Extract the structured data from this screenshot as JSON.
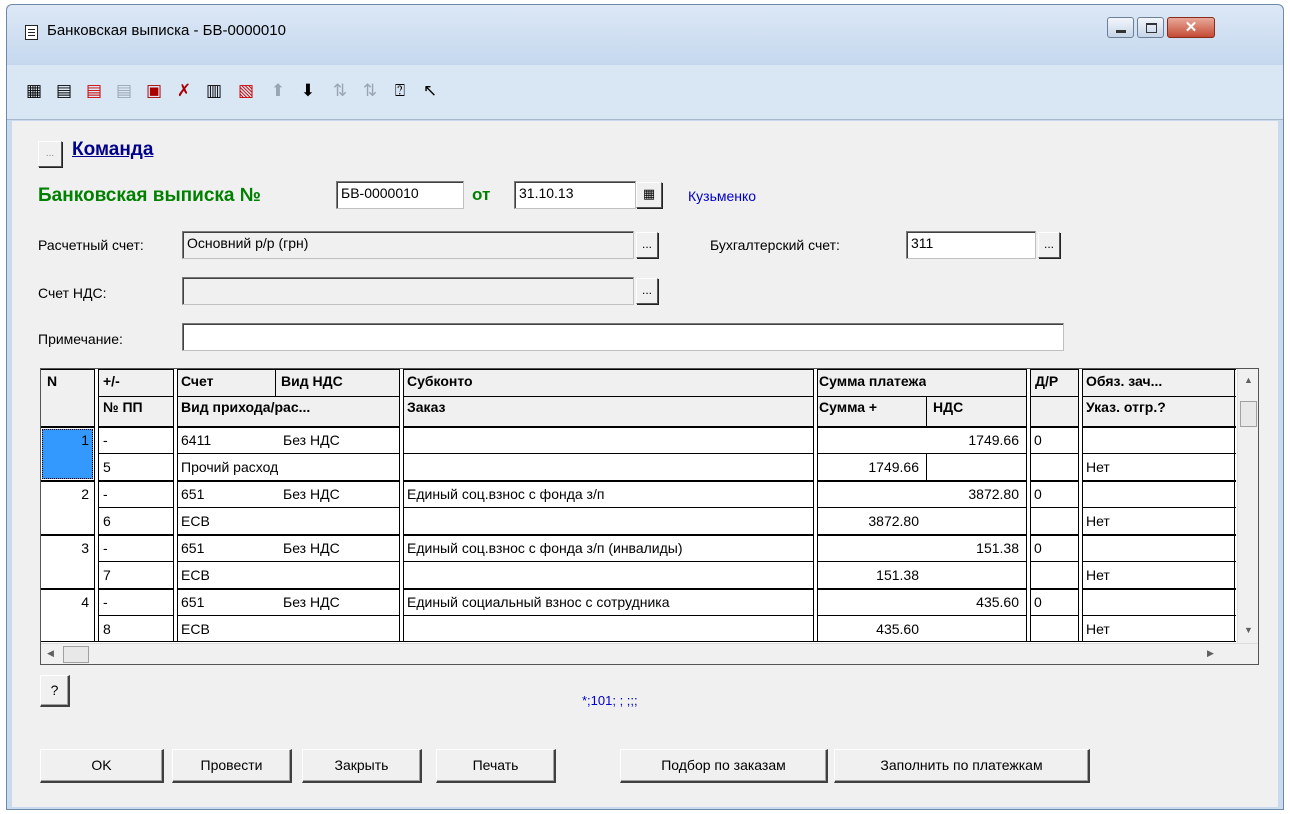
{
  "window": {
    "title": "Банковская выписка - БВ-0000010",
    "close_glyph": "✕"
  },
  "toolbar": {
    "icons": [
      "new-row-icon",
      "add-row-icon",
      "delete-row-icon",
      "copy-row-icon",
      "delete-doc-icon",
      "dk-icon",
      "insert-icon",
      "select-icon",
      "move-up-icon",
      "move-down-icon",
      "sort-asc-icon",
      "sort-desc-icon",
      "help-icon",
      "context-help-icon"
    ]
  },
  "command": {
    "label": "Команда",
    "button_glyph": "..."
  },
  "header": {
    "doc_label": "Банковская выписка №",
    "number": "БВ-0000010",
    "date_label": "от",
    "date": "31.10.13",
    "author": "Кузьменко"
  },
  "fields": {
    "account_label": "Расчетный счет:",
    "account_value": "Основний р/р (грн)",
    "gl_label": "Бухгалтерский счет:",
    "gl_value": "311",
    "vat_label": "Счет НДС:",
    "vat_value": "",
    "note_label": "Примечание:",
    "note_value": ""
  },
  "table": {
    "headers1": [
      "N",
      "+/-",
      "Счет",
      "Вид НДС",
      "Субконто",
      "Сумма платежа",
      "Д/Р",
      "Обяз. зач..."
    ],
    "headers2": [
      "№ ПП",
      "Вид прихода/рас...",
      "Заказ",
      "Сумма +",
      "НДС",
      "Указ. отгр.?"
    ],
    "rows": [
      {
        "n": "1",
        "sign": "-",
        "acct": "6411",
        "vat": "Без НДС",
        "subkonto": "",
        "sum": "1749.66",
        "dr": "0",
        "obyaz": "",
        "pp": "5",
        "vid": "Прочий расход",
        "order": "",
        "sum_plus": "1749.66",
        "nds": "",
        "ukaz": "Нет"
      },
      {
        "n": "2",
        "sign": "-",
        "acct": "651",
        "vat": "Без НДС",
        "subkonto": "Единый соц.взнос с фонда з/п",
        "sum": "3872.80",
        "dr": "0",
        "obyaz": "",
        "pp": "6",
        "vid": "ЕСВ",
        "order": "",
        "sum_plus": "3872.80",
        "nds": "",
        "ukaz": "Нет"
      },
      {
        "n": "3",
        "sign": "-",
        "acct": "651",
        "vat": "Без НДС",
        "subkonto": "Единый соц.взнос с фонда з/п (инвалиды)",
        "sum": "151.38",
        "dr": "0",
        "obyaz": "",
        "pp": "7",
        "vid": "ЕСВ",
        "order": "",
        "sum_plus": "151.38",
        "nds": "",
        "ukaz": "Нет"
      },
      {
        "n": "4",
        "sign": "-",
        "acct": "651",
        "vat": "Без НДС",
        "subkonto": "Единый социальный взнос с сотрудника",
        "sum": "435.60",
        "dr": "0",
        "obyaz": "",
        "pp": "8",
        "vid": "ЕСВ",
        "order": "",
        "sum_plus": "435.60",
        "nds": "",
        "ukaz": "Нет"
      }
    ]
  },
  "status_text": "*;101; ; ;;;",
  "help_button": "?",
  "buttons": {
    "ok": "OK",
    "post": "Провести",
    "close": "Закрыть",
    "print": "Печать",
    "pick": "Подбор по заказам",
    "fill": "Заполнить по платежкам"
  }
}
